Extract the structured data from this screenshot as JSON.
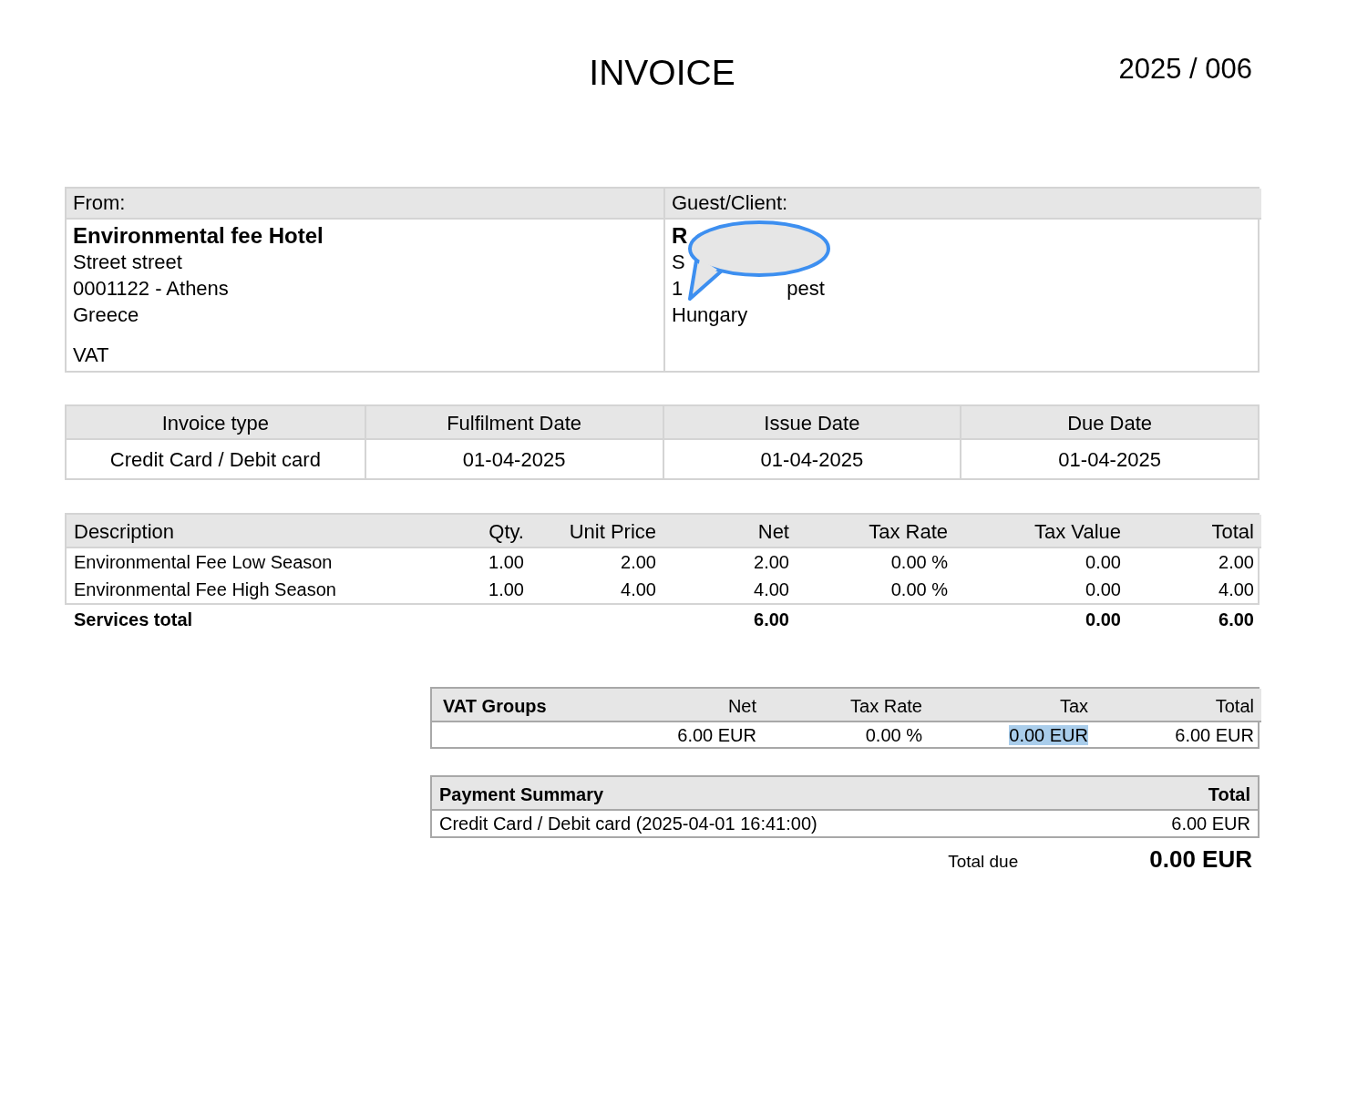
{
  "title": "INVOICE",
  "number": "2025 / 006",
  "from": {
    "label": "From:",
    "name": "Environmental fee Hotel",
    "lines": [
      "Street street",
      "0001122 - Athens",
      "Greece"
    ],
    "vat": "VAT"
  },
  "guest": {
    "label": "Guest/Client:",
    "name": "R",
    "street": "S",
    "city_start": "1",
    "city_end": "pest",
    "country": "Hungary"
  },
  "dates": {
    "columns": [
      "Invoice type",
      "Fulfilment Date",
      "Issue Date",
      "Due Date"
    ],
    "values": [
      "Credit Card / Debit card",
      "01-04-2025",
      "01-04-2025",
      "01-04-2025"
    ]
  },
  "items": {
    "columns": [
      "Description",
      "Qty.",
      "Unit Price",
      "Net",
      "Tax Rate",
      "Tax Value",
      "Total"
    ],
    "rows": [
      {
        "cells": [
          "Environmental Fee Low Season",
          "1.00",
          "2.00",
          "2.00",
          "0.00 %",
          "0.00",
          "2.00"
        ]
      },
      {
        "cells": [
          "Environmental Fee High Season",
          "1.00",
          "4.00",
          "4.00",
          "0.00 %",
          "0.00",
          "4.00"
        ]
      }
    ],
    "total_row": {
      "label": "Services total",
      "net": "6.00",
      "tax_value": "0.00",
      "total": "6.00"
    }
  },
  "vat_groups": {
    "columns": [
      "VAT Groups",
      "Net",
      "Tax Rate",
      "Tax",
      "Total"
    ],
    "rows": [
      {
        "cells": [
          null,
          {
            "text": "6.00 EUR",
            "highlighted": false
          },
          {
            "text": "0.00 %",
            "highlighted": false
          },
          {
            "text": "0.00 EUR",
            "highlighted": true
          },
          {
            "text": "6.00 EUR",
            "highlighted": false
          }
        ]
      }
    ]
  },
  "payment_summary": {
    "columns": [
      "Payment Summary",
      "Total"
    ],
    "rows": [
      {
        "cells": [
          "Credit Card / Debit card (2025-04-01 16:41:00)",
          "6.00 EUR"
        ]
      }
    ]
  },
  "total_due": {
    "label": "Total due",
    "value": "0.00 EUR"
  }
}
